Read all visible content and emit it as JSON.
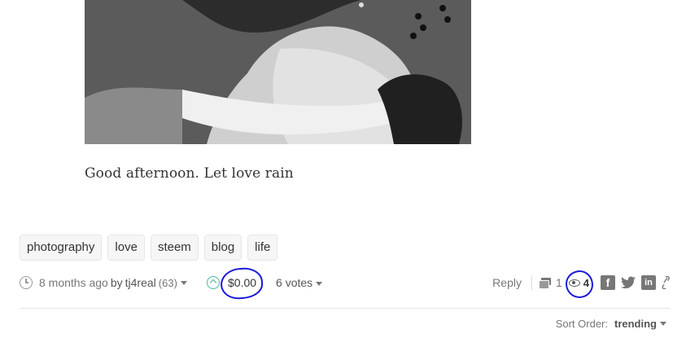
{
  "post": {
    "body": "Good afternoon. Let love rain"
  },
  "tags": [
    "photography",
    "love",
    "steem",
    "blog",
    "life"
  ],
  "meta": {
    "time": "8 months ago",
    "by": "by",
    "author": "tj4real",
    "reputation": "(63)",
    "payout": "$0.00",
    "votes": "6 votes",
    "reply": "Reply",
    "comments": "1",
    "views": "4"
  },
  "sort": {
    "label": "Sort Order:",
    "value": "trending"
  },
  "colors": {
    "annotation": "#1b1bd8",
    "upvote": "#4ab6a0"
  }
}
